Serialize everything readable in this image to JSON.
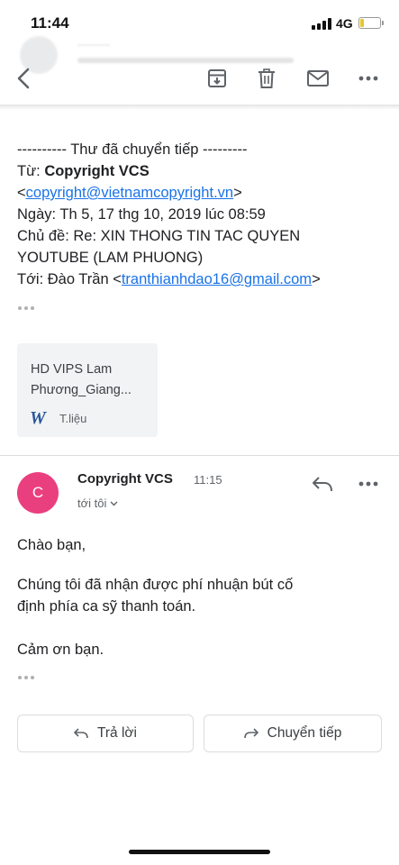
{
  "status_bar": {
    "time": "11:44",
    "network": "4G",
    "battery_level": 0.2
  },
  "toolbar": {
    "icons": [
      "back-arrow-icon",
      "archive-icon",
      "trash-icon",
      "mail-icon",
      "more-icon"
    ]
  },
  "forwarded": {
    "header": "---------- Thư đã chuyển tiếp ---------",
    "from_label": "Từ:",
    "from_name": "Copyright VCS",
    "from_email_open": "<",
    "from_email": "copyright@vietnamcopyright.vn",
    "from_email_close": ">",
    "date_label": "Ngày:",
    "date_value": "Th 5, 17 thg 10, 2019 lúc 08:59",
    "subject_label": "Chủ đề:",
    "subject_value": "Re: XIN THONG TIN TAC QUYEN",
    "subject_value_2": "YOUTUBE (LAM PHUONG)",
    "to_label": "Tới:",
    "to_name": "Đào Trần <",
    "to_email": "tranthianhdao16@gmail.com",
    "to_email_close": ">"
  },
  "attachment": {
    "name_line1": "HD VIPS Lam",
    "name_line2": "Phương_Giang...",
    "type_label": "T.liệu"
  },
  "message": {
    "avatar_letter": "C",
    "avatar_color": "#ea3f7f",
    "sender": "Copyright VCS",
    "time": "11:15",
    "recipient": "tới tôi",
    "greeting": "Chào bạn,",
    "body_line1": "Chúng tôi đã nhận được phí nhuận bút cố",
    "body_line2": "định phía ca sỹ thanh toán.",
    "thanks": "Cảm ơn bạn."
  },
  "actions": {
    "reply": "Trả lời",
    "forward": "Chuyển tiếp"
  }
}
